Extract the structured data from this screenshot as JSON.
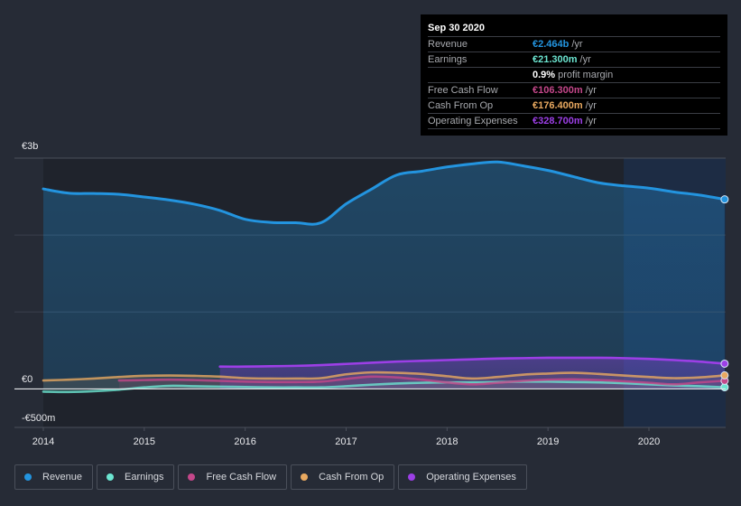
{
  "tooltip": {
    "date": "Sep 30 2020",
    "rows": [
      {
        "label": "Revenue",
        "value": "€2.464b",
        "unit": "/yr",
        "color": "#2394df"
      },
      {
        "label": "Earnings",
        "value": "€21.300m",
        "unit": "/yr",
        "color": "#6ce5d1"
      },
      {
        "label": "",
        "value": "0.9%",
        "unit": "profit margin",
        "color": "#ffffff"
      },
      {
        "label": "Free Cash Flow",
        "value": "€106.300m",
        "unit": "/yr",
        "color": "#c4478a"
      },
      {
        "label": "Cash From Op",
        "value": "€176.400m",
        "unit": "/yr",
        "color": "#e9a960"
      },
      {
        "label": "Operating Expenses",
        "value": "€328.700m",
        "unit": "/yr",
        "color": "#9c3fe6"
      }
    ]
  },
  "legend": [
    {
      "label": "Revenue",
      "color": "#2394df"
    },
    {
      "label": "Earnings",
      "color": "#6ce5d1"
    },
    {
      "label": "Free Cash Flow",
      "color": "#c4478a"
    },
    {
      "label": "Cash From Op",
      "color": "#e9a960"
    },
    {
      "label": "Operating Expenses",
      "color": "#9c3fe6"
    }
  ],
  "chart_data": {
    "type": "area",
    "title": "",
    "xlabel": "",
    "ylabel": "",
    "currency": "EUR",
    "xlim": [
      2013.85,
      2020.75
    ],
    "ylim": [
      -500,
      3000
    ],
    "y_unit": "€m",
    "y_ticks": [
      {
        "value": 3000,
        "label": "€3b"
      },
      {
        "value": 0,
        "label": "€0"
      },
      {
        "value": -500,
        "label": "-€500m"
      }
    ],
    "x_ticks": [
      "2014",
      "2015",
      "2016",
      "2017",
      "2018",
      "2019",
      "2020"
    ],
    "x_tick_values": [
      2014,
      2015,
      2016,
      2017,
      2018,
      2019,
      2020
    ],
    "highlight_from": 2019.75,
    "grid": true,
    "legend_position": "bottom-left",
    "series": [
      {
        "name": "Revenue",
        "color": "#2394df",
        "x": [
          2014.0,
          2014.25,
          2014.5,
          2014.75,
          2015.0,
          2015.25,
          2015.5,
          2015.75,
          2016.0,
          2016.25,
          2016.5,
          2016.75,
          2017.0,
          2017.25,
          2017.5,
          2017.75,
          2018.0,
          2018.25,
          2018.5,
          2018.75,
          2019.0,
          2019.25,
          2019.5,
          2019.75,
          2020.0,
          2020.25,
          2020.5,
          2020.75
        ],
        "values": [
          2600,
          2545,
          2540,
          2530,
          2495,
          2455,
          2400,
          2320,
          2205,
          2165,
          2160,
          2160,
          2405,
          2595,
          2780,
          2830,
          2885,
          2925,
          2950,
          2900,
          2840,
          2760,
          2680,
          2640,
          2610,
          2560,
          2520,
          2464
        ]
      },
      {
        "name": "Earnings",
        "color": "#6ce5d1",
        "x": [
          2014.0,
          2014.25,
          2014.5,
          2014.75,
          2015.0,
          2015.25,
          2015.5,
          2015.75,
          2016.0,
          2016.25,
          2016.5,
          2016.75,
          2017.0,
          2017.25,
          2017.5,
          2017.75,
          2018.0,
          2018.25,
          2018.5,
          2018.75,
          2019.0,
          2019.25,
          2019.5,
          2019.75,
          2020.0,
          2020.25,
          2020.5,
          2020.75
        ],
        "values": [
          -35,
          -40,
          -30,
          -10,
          20,
          40,
          35,
          30,
          25,
          20,
          20,
          20,
          35,
          55,
          70,
          80,
          85,
          85,
          90,
          95,
          95,
          90,
          85,
          75,
          60,
          45,
          35,
          21.3
        ]
      },
      {
        "name": "Free Cash Flow",
        "color": "#c4478a",
        "x": [
          2014.75,
          2015.0,
          2015.25,
          2015.5,
          2015.75,
          2016.0,
          2016.25,
          2016.5,
          2016.75,
          2017.0,
          2017.25,
          2017.5,
          2017.75,
          2018.0,
          2018.25,
          2018.5,
          2018.75,
          2019.0,
          2019.25,
          2019.5,
          2019.75,
          2020.0,
          2020.25,
          2020.5,
          2020.75
        ],
        "values": [
          110,
          115,
          120,
          115,
          105,
          95,
          90,
          90,
          95,
          130,
          160,
          150,
          120,
          85,
          60,
          80,
          105,
          120,
          125,
          115,
          100,
          80,
          60,
          85,
          106.3
        ]
      },
      {
        "name": "Cash From Op",
        "color": "#e9a960",
        "x": [
          2014.0,
          2014.25,
          2014.5,
          2014.75,
          2015.0,
          2015.25,
          2015.5,
          2015.75,
          2016.0,
          2016.25,
          2016.5,
          2016.75,
          2017.0,
          2017.25,
          2017.5,
          2017.75,
          2018.0,
          2018.25,
          2018.5,
          2018.75,
          2019.0,
          2019.25,
          2019.5,
          2019.75,
          2020.0,
          2020.25,
          2020.5,
          2020.75
        ],
        "values": [
          110,
          120,
          135,
          155,
          170,
          175,
          170,
          160,
          140,
          135,
          135,
          140,
          190,
          215,
          210,
          195,
          165,
          135,
          155,
          185,
          200,
          210,
          195,
          175,
          155,
          140,
          150,
          176.4
        ]
      },
      {
        "name": "Operating Expenses",
        "color": "#9c3fe6",
        "x": [
          2015.75,
          2016.0,
          2016.25,
          2016.5,
          2016.75,
          2017.0,
          2017.25,
          2017.5,
          2017.75,
          2018.0,
          2018.25,
          2018.5,
          2018.75,
          2019.0,
          2019.25,
          2019.5,
          2019.75,
          2020.0,
          2020.25,
          2020.5,
          2020.75
        ],
        "values": [
          290,
          290,
          295,
          300,
          310,
          325,
          340,
          355,
          365,
          375,
          385,
          395,
          400,
          405,
          405,
          405,
          400,
          390,
          375,
          355,
          328.7
        ]
      }
    ]
  }
}
